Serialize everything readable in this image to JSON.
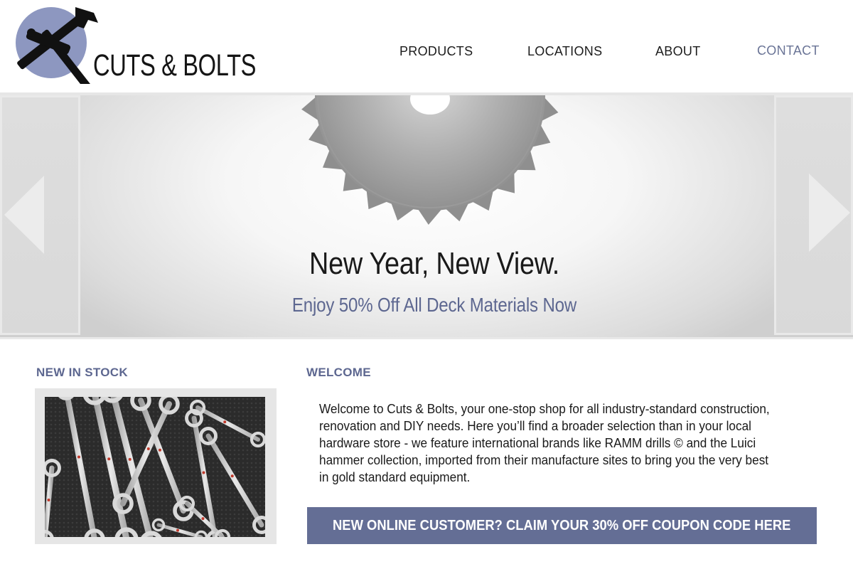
{
  "brand": {
    "name": "CUTS & BOLTS",
    "accent": "#5d6790",
    "logo_circle": "#8d97c0"
  },
  "nav": {
    "items": [
      {
        "label": "PRODUCTS"
      },
      {
        "label": "LOCATIONS"
      },
      {
        "label": "ABOUT"
      },
      {
        "label": "CONTACT",
        "active": true
      }
    ]
  },
  "hero": {
    "title": "New Year, New View.",
    "subtitle": "Enjoy 50% Off All Deck Materials Now",
    "image": "saw-blade",
    "prev_icon": "triangle-left-icon",
    "next_icon": "triangle-right-icon"
  },
  "new_in_stock": {
    "heading": "NEW IN STOCK",
    "image": "wrench-set-photo"
  },
  "welcome": {
    "heading": "WELCOME",
    "lines": [
      "Welcome to Cuts & Bolts, your one-stop shop for all industry-standard construction,",
      "renovation and DIY needs. Here you’ll find a broader selection than in your local",
      "hardware store - we feature international brands like RAMM drills © and the Luici",
      "hammer collection, imported from their manufacture sites to bring you the very best",
      "in gold standard equipment."
    ]
  },
  "coupon": {
    "label": "NEW ONLINE CUSTOMER? CLAIM YOUR 30% OFF COUPON CODE HERE",
    "color": "#646e95"
  }
}
